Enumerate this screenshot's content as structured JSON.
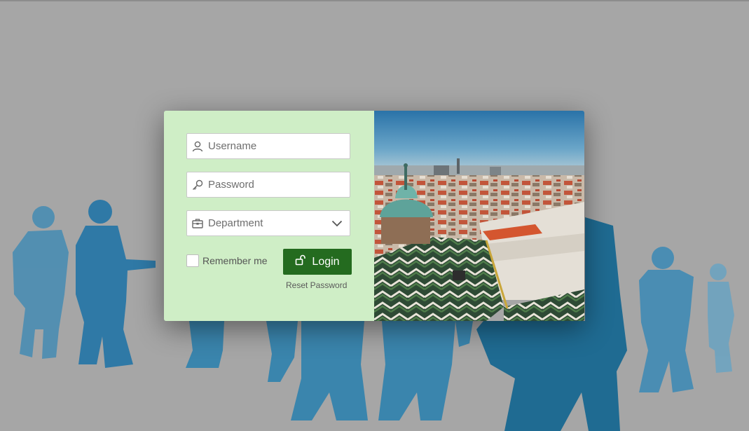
{
  "login_form": {
    "username_placeholder": "Username",
    "password_placeholder": "Password",
    "department_selected": "Department",
    "remember_label": "Remember me",
    "remember_checked": false,
    "login_label": "Login",
    "reset_label": "Reset Password"
  },
  "icons": {
    "username": "user-icon",
    "password": "key-icon",
    "department": "briefcase-icon",
    "dropdown": "chevron-down-icon",
    "login": "unlock-icon"
  },
  "colors": {
    "background": "#a6a6a6",
    "form_panel": "#cfeec6",
    "login_button": "#246b1f",
    "silhouettes": "#3b7fa6"
  }
}
